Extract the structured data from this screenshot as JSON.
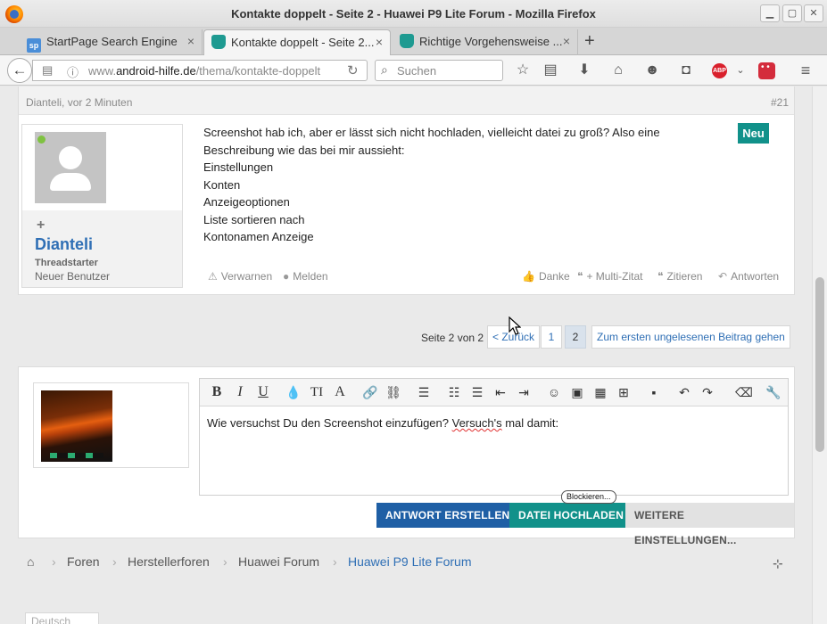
{
  "window": {
    "title": "Kontakte doppelt - Seite 2 - Huawei P9 Lite Forum - Mozilla Firefox",
    "minimize": "▫",
    "maximize": "▫",
    "close": "✕"
  },
  "tabs": [
    {
      "label": "StartPage Search Engine",
      "icon": "sp"
    },
    {
      "label": "Kontakte doppelt - Seite 2...",
      "icon": "android-hilfe"
    },
    {
      "label": "Richtige Vorgehensweise ...",
      "icon": "android-hilfe"
    }
  ],
  "new_tab": "+",
  "tab_close": "×",
  "nav": {
    "url_prefix": "www.",
    "url_domain": "android-hilfe.de",
    "url_path": "/thema/kontakte-doppelt",
    "search_placeholder": "Suchen",
    "abp_label": "ABP"
  },
  "post": {
    "meta": "Dianteli, vor 2 Minuten",
    "number": "#21",
    "badge": "Neu",
    "user": {
      "name": "Dianteli",
      "role": "Threadstarter",
      "title": "Neuer Benutzer"
    },
    "lines": [
      "Screenshot hab ich, aber er lässt sich nicht hochladen, vielleicht datei zu groß? Also eine",
      "Beschreibung wie das bei mir aussieht:",
      "Einstellungen",
      "Konten",
      "Anzeigeoptionen",
      "Liste sortieren nach",
      "Kontonamen Anzeige"
    ],
    "actions_left": [
      "Verwarnen",
      "Melden"
    ],
    "actions_right": [
      "Danke",
      "+ Multi-Zitat",
      "Zitieren",
      "Antworten"
    ]
  },
  "pagination": {
    "label": "Seite 2 von 2",
    "prev": "< Zurück",
    "pages": [
      "1",
      "2"
    ],
    "current": "2",
    "first_unread": "Zum ersten ungelesenen Beitrag gehen"
  },
  "reply": {
    "editor_text_before": "Wie versuchst Du den Screenshot einzufügen? ",
    "editor_text_spell": "Versuch's",
    "editor_text_after": " mal damit:",
    "buttons": {
      "submit": "Antwort erstellen",
      "upload": "Datei hochladen",
      "more": "Weitere Einstellungen..."
    },
    "tooltip": "Blockieren..."
  },
  "breadcrumbs": [
    "Foren",
    "Herstellerforen",
    "Huawei Forum",
    "Huawei P9 Lite Forum"
  ],
  "bottom_chip": "Deutsch"
}
